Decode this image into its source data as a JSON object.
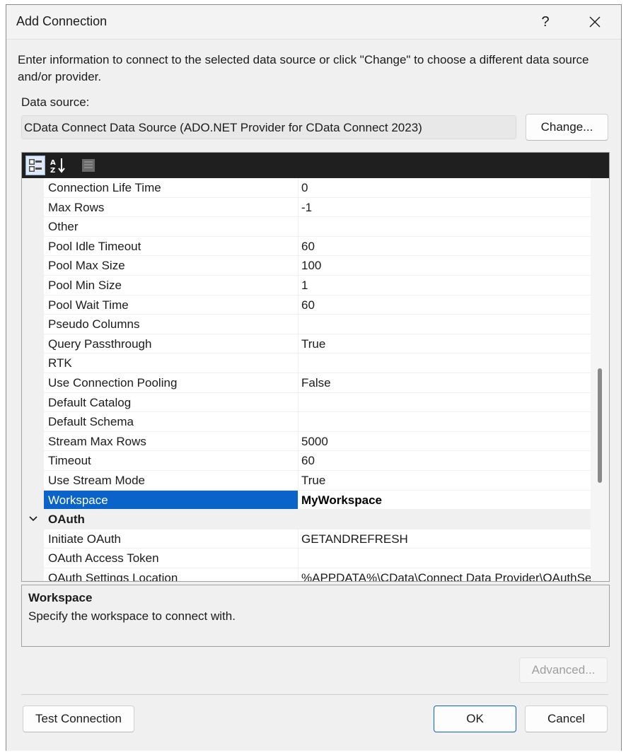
{
  "window": {
    "title": "Add Connection",
    "help_label": "?"
  },
  "description": "Enter information to connect to the selected data source or click \"Change\" to choose a different data source and/or provider.",
  "data_source": {
    "label": "Data source:",
    "value": "CData Connect Data Source (ADO.NET Provider for CData Connect 2023)",
    "change_label": "Change..."
  },
  "property_grid": {
    "toolbar": [
      "categorized-icon",
      "alphabetical-icon",
      "property-pages-icon"
    ],
    "rows": [
      {
        "name": "Connection Life Time",
        "value": "0"
      },
      {
        "name": "Max Rows",
        "value": "-1"
      },
      {
        "name": "Other",
        "value": ""
      },
      {
        "name": "Pool Idle Timeout",
        "value": "60"
      },
      {
        "name": "Pool Max Size",
        "value": "100"
      },
      {
        "name": "Pool Min Size",
        "value": "1"
      },
      {
        "name": "Pool Wait Time",
        "value": "60"
      },
      {
        "name": "Pseudo Columns",
        "value": ""
      },
      {
        "name": "Query Passthrough",
        "value": "True"
      },
      {
        "name": "RTK",
        "value": ""
      },
      {
        "name": "Use Connection Pooling",
        "value": "False"
      },
      {
        "name": "Default Catalog",
        "value": ""
      },
      {
        "name": "Default Schema",
        "value": ""
      },
      {
        "name": "Stream Max Rows",
        "value": "5000"
      },
      {
        "name": "Timeout",
        "value": "60"
      },
      {
        "name": "Use Stream Mode",
        "value": "True"
      },
      {
        "name": "Workspace",
        "value": "MyWorkspace",
        "selected": true
      },
      {
        "name": "OAuth",
        "value": "",
        "category": true
      },
      {
        "name": "Initiate OAuth",
        "value": "GETANDREFRESH"
      },
      {
        "name": "OAuth Access Token",
        "value": ""
      },
      {
        "name": "OAuth Settings Location",
        "value": "%APPDATA%\\CData\\Connect Data Provider\\OAuthSettings.txt"
      }
    ]
  },
  "help": {
    "title": "Workspace",
    "description": "Specify the workspace to connect with."
  },
  "buttons": {
    "advanced": "Advanced...",
    "test_connection": "Test Connection",
    "ok": "OK",
    "cancel": "Cancel"
  },
  "colors": {
    "selection": "#0a63c8",
    "toolbar": "#1f1f1f"
  }
}
